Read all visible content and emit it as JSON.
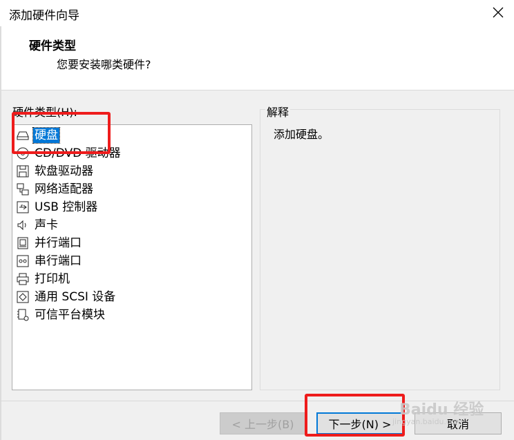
{
  "window": {
    "title": "添加硬件向导"
  },
  "header": {
    "title": "硬件类型",
    "subtitle": "您要安装哪类硬件?"
  },
  "list": {
    "label": "硬件类型(H):",
    "items": [
      {
        "label": "硬盘",
        "icon": "hard-disk-icon"
      },
      {
        "label": "CD/DVD 驱动器",
        "icon": "cd-dvd-icon"
      },
      {
        "label": "软盘驱动器",
        "icon": "floppy-icon"
      },
      {
        "label": "网络适配器",
        "icon": "network-adapter-icon"
      },
      {
        "label": "USB 控制器",
        "icon": "usb-icon"
      },
      {
        "label": "声卡",
        "icon": "speaker-icon"
      },
      {
        "label": "并行端口",
        "icon": "parallel-port-icon"
      },
      {
        "label": "串行端口",
        "icon": "serial-port-icon"
      },
      {
        "label": "打印机",
        "icon": "printer-icon"
      },
      {
        "label": "通用 SCSI 设备",
        "icon": "scsi-icon"
      },
      {
        "label": "可信平台模块",
        "icon": "tpm-icon"
      }
    ],
    "selected_index": 0
  },
  "explanation": {
    "label": "解释",
    "text": "添加硬盘。"
  },
  "buttons": {
    "back": "< 上一步(B)",
    "next": "下一步(N) >",
    "cancel": "取消"
  },
  "watermark": {
    "brand": "Baidu 经验",
    "url": "jingyan.baidu.com"
  },
  "colors": {
    "selection": "#0078d7",
    "highlight_box": "#ee1c1c"
  }
}
